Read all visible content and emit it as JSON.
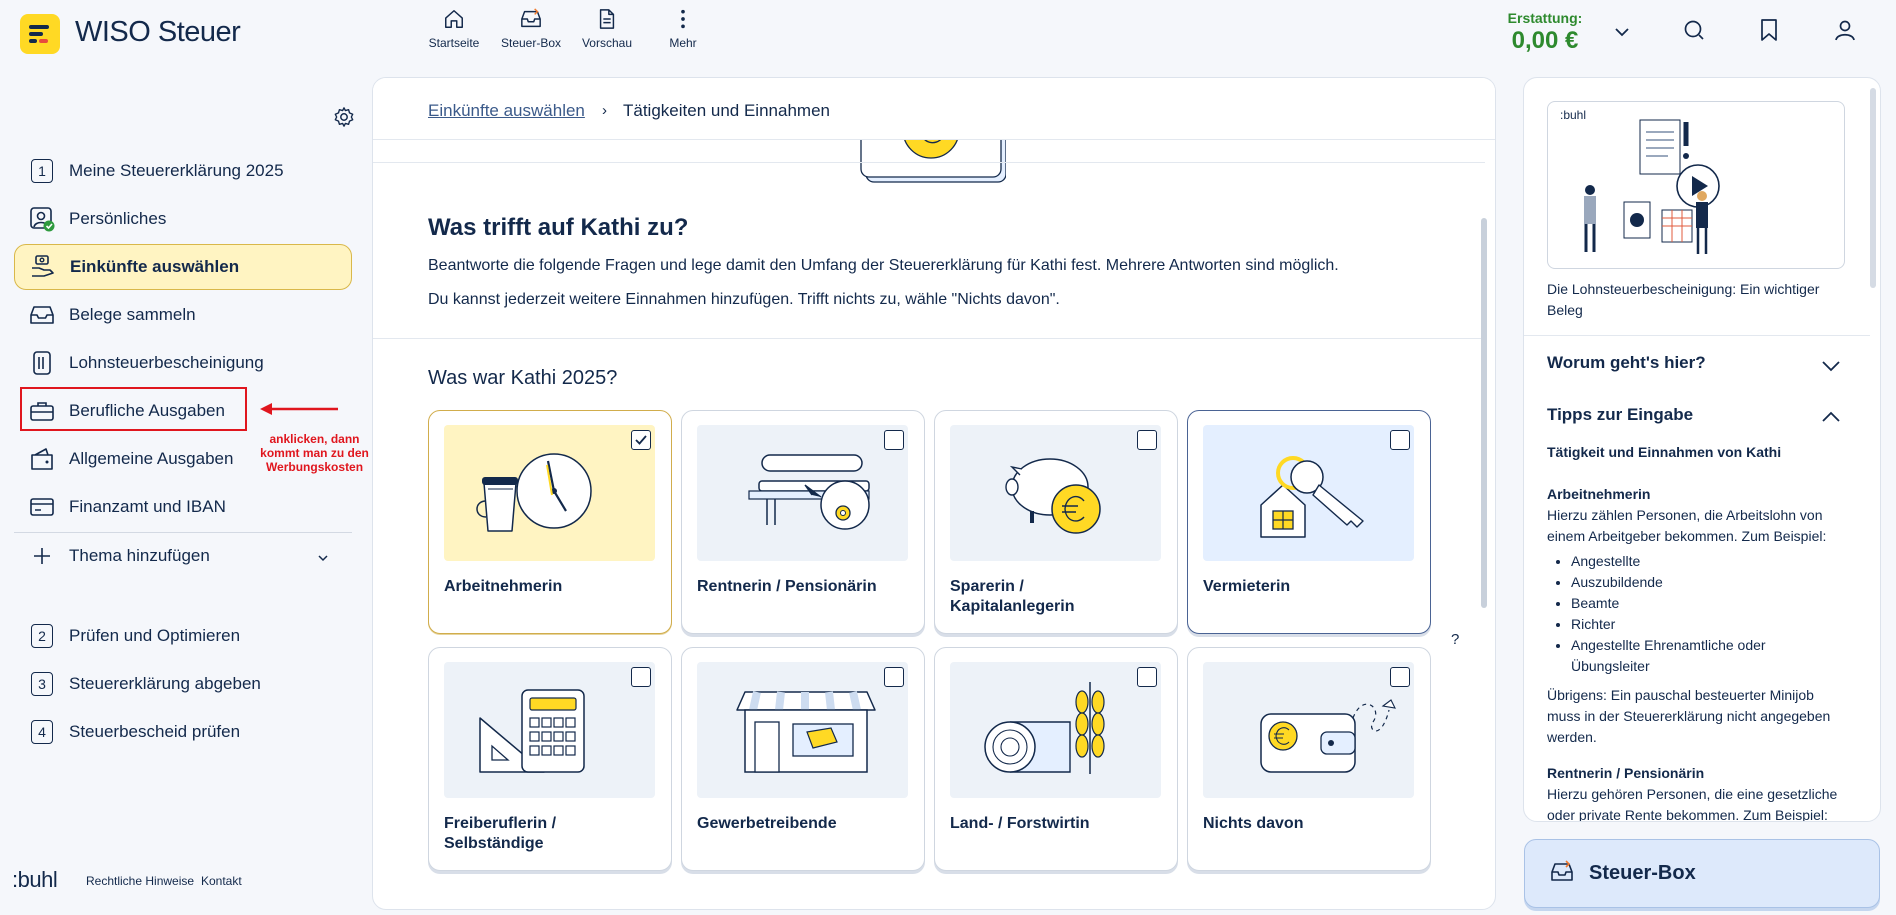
{
  "app": {
    "brand": "WISO Steuer"
  },
  "topnav": [
    {
      "label": "Startseite",
      "icon": "home-icon"
    },
    {
      "label": "Steuer-Box",
      "icon": "steuerbox-icon"
    },
    {
      "label": "Vorschau",
      "icon": "document-icon"
    },
    {
      "label": "Mehr",
      "icon": "more-icon"
    }
  ],
  "refund": {
    "label": "Erstattung:",
    "value": "0,00 €",
    "color": "#2e8a2e"
  },
  "sidebar": {
    "items": [
      {
        "label": "Meine Steuererklärung 2025",
        "icon": "step-number-1",
        "num": "1"
      },
      {
        "label": "Persönliches",
        "icon": "person-check-icon"
      },
      {
        "label": "Einkünfte auswählen",
        "icon": "income-hand-icon"
      },
      {
        "label": "Belege sammeln",
        "icon": "inbox-icon"
      },
      {
        "label": "Lohnsteuerbescheinigung",
        "icon": "certificate-icon"
      },
      {
        "label": "Berufliche Ausgaben",
        "icon": "briefcase-icon"
      },
      {
        "label": "Allgemeine Ausgaben",
        "icon": "wallet-icon"
      },
      {
        "label": "Finanzamt und IBAN",
        "icon": "card-icon"
      },
      {
        "label": "Thema hinzufügen",
        "icon": "plus-icon"
      }
    ],
    "steps": [
      {
        "num": "2",
        "label": "Prüfen und Optimieren"
      },
      {
        "num": "3",
        "label": "Steuererklärung abgeben"
      },
      {
        "num": "4",
        "label": "Steuerbescheid prüfen"
      }
    ],
    "annotation": "anklicken, dann kommt man zu den Werbungskosten",
    "footer": {
      "logo": ":buhl",
      "legal": "Rechtliche Hinweise",
      "contact": "Kontakt"
    }
  },
  "breadcrumb": {
    "parent": "Einkünfte auswählen",
    "current": "Tätigkeiten und Einnahmen"
  },
  "main": {
    "heading": "Was trifft auf Kathi zu?",
    "intro1": "Beantworte die folgende Fragen und lege damit den Umfang der Steuererklärung für Kathi fest. Mehrere Antworten sind möglich.",
    "intro2": "Du kannst jederzeit weitere Einnahmen hinzufügen. Trifft nichts zu, wähle \"Nichts davon\".",
    "question": "Was war Kathi 2025?",
    "help": "?",
    "options": [
      {
        "label": "Arbeitnehmerin",
        "checked": true
      },
      {
        "label": "Rentnerin / Pensionärin",
        "checked": false
      },
      {
        "label": "Sparerin / Kapitalanlegerin",
        "checked": false
      },
      {
        "label": "Vermieterin",
        "checked": false
      },
      {
        "label": "Freiberuflerin / Selbständige",
        "checked": false
      },
      {
        "label": "Gewerbetreibende",
        "checked": false
      },
      {
        "label": "Land- / Forstwirtin",
        "checked": false
      },
      {
        "label": "Nichts davon",
        "checked": false
      }
    ]
  },
  "right": {
    "video_logo": ":buhl",
    "video_caption": "Die Lohnsteuerbescheinigung: Ein wichtiger Beleg",
    "acc1": "Worum geht's hier?",
    "acc2": "Tipps zur Eingabe",
    "tips_title": "Tätigkeit und Einnahmen von Kathi",
    "an_title": "Arbeitnehmerin",
    "an_text": "Hierzu zählen Personen, die Arbeitslohn von einem Arbeitgeber bekommen. Zum Beispiel:",
    "an_list": [
      "Angestellte",
      "Auszubildende",
      "Beamte",
      "Richter",
      "Angestellte Ehrenamtliche oder Übungsleiter"
    ],
    "minijob": "Übrigens: Ein pauschal besteuerter Minijob muss in der Steuererklärung nicht angegeben werden.",
    "rp_title": "Rentnerin / Pensionärin",
    "rp_text": "Hierzu gehören Personen, die eine gesetzliche oder private Rente bekommen. Zum Beispiel:"
  },
  "steuerbox": {
    "label": "Steuer-Box"
  },
  "colors": {
    "brand_yellow": "#ffd924",
    "navy": "#13294b",
    "annotation_red": "#e0161e",
    "selected_bg": "#fff4c2"
  }
}
